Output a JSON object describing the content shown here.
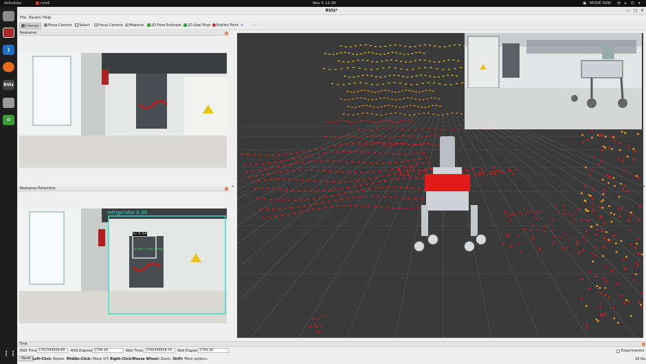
{
  "topbar": {
    "activities": "Activities",
    "app_name": "rviz2",
    "clock": "Nov 5  12:38",
    "power_mode": "MODE 50W"
  },
  "dock": {
    "rviz_label": "RViz"
  },
  "window": {
    "title": "RViz*"
  },
  "menu": {
    "file": "File",
    "panels": "Panels",
    "help": "Help"
  },
  "toolbar": {
    "interact": "Interact",
    "move_camera": "Move Camera",
    "select": "Select",
    "focus_camera": "Focus Camera",
    "measure": "Measure",
    "pose_estimate": "2D Pose Estimate",
    "goal_pose": "2D Goal Pose",
    "publish_point": "Publish Point",
    "plus": "+",
    "minus": "−"
  },
  "panels": {
    "realsense": "Realsense",
    "detections": "Realsense Detections"
  },
  "detections": {
    "label_refrigerator": "refrigerator 0.39",
    "label_tv": "tv 0.54",
    "coords_text": "(-0.43m, -0.33m, 3.55m)"
  },
  "time_panel": {
    "title": "Time",
    "ros_time_label": "ROS Time:",
    "ros_time": "1762343928.89",
    "ros_elapsed_label": "ROS Elapsed:",
    "ros_elapsed": "1794.18",
    "wall_time_label": "Wall Time:",
    "wall_time": "1762343928.76",
    "wall_elapsed_label": "Wall Elapsed:",
    "wall_elapsed": "1794.18",
    "experimental": "Experimental"
  },
  "status": {
    "reset": "Reset",
    "hint_left_b": "Left-Click:",
    "hint_left": " Rotate. ",
    "hint_mid_b": "Middle-Click:",
    "hint_mid": " Move X/Y. ",
    "hint_right_b": "Right-Click/Mouse Wheel:",
    "hint_right": " Zoom. ",
    "hint_shift_b": "Shift:",
    "hint_shift": " More options.",
    "fps": "18 fps"
  },
  "colors": {
    "detection_box": "#39e0c8",
    "point_red": "#e4141a",
    "point_yellow": "#e8c020"
  }
}
